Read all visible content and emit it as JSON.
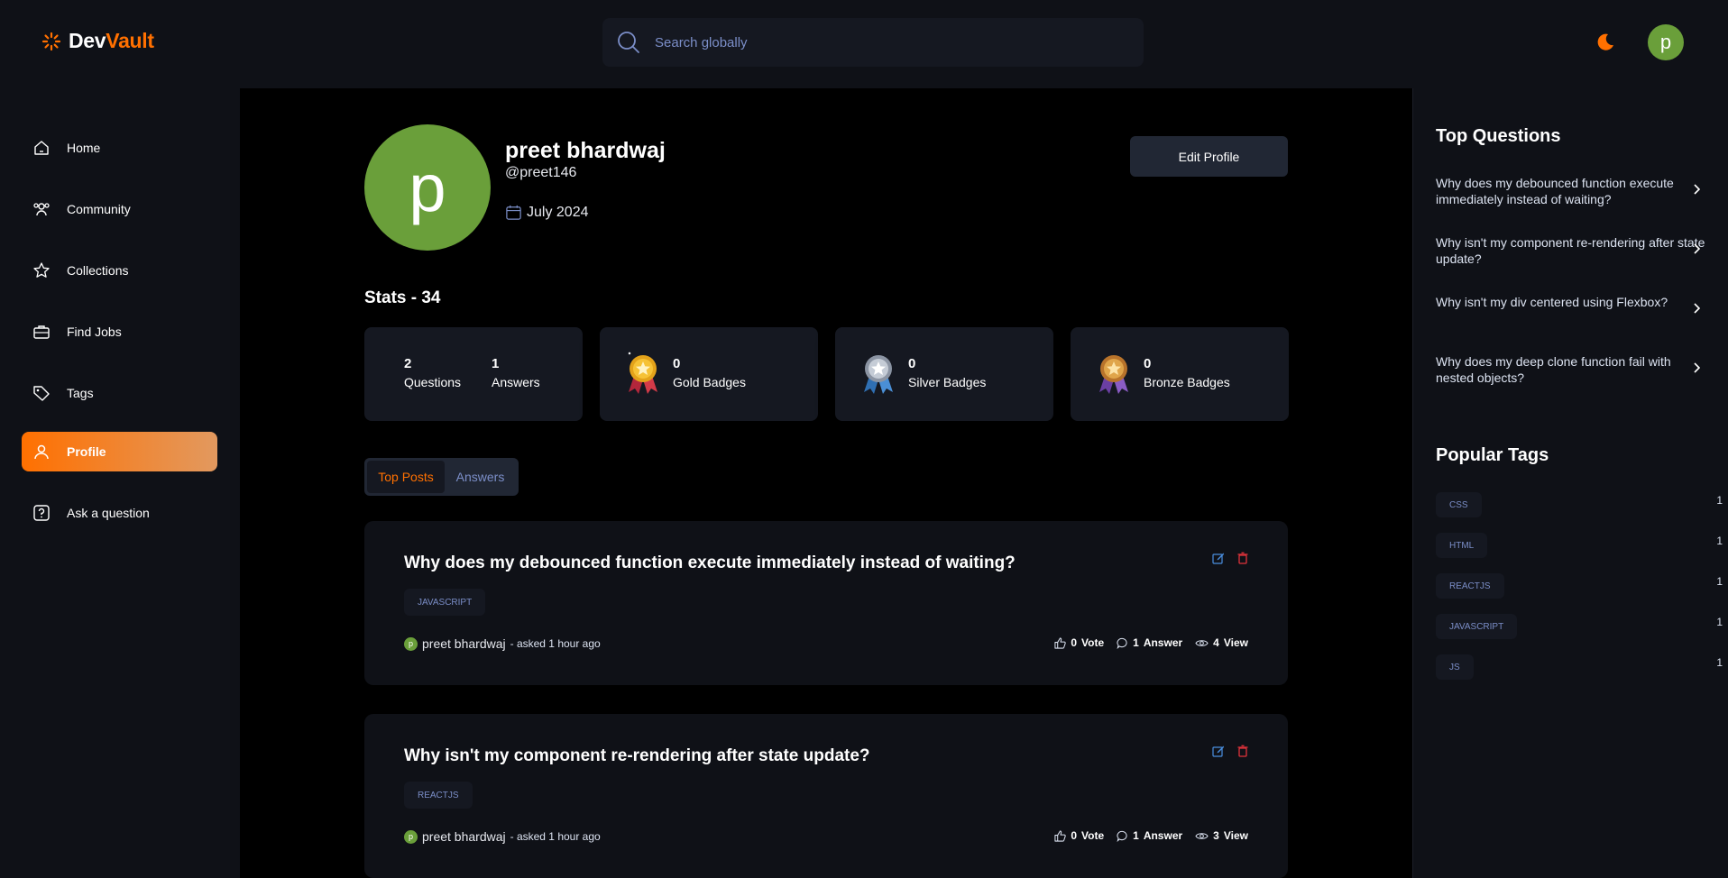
{
  "brand": {
    "name_first": "Dev",
    "name_second": "Vault"
  },
  "search": {
    "placeholder": "Search globally"
  },
  "user": {
    "avatar_letter": "p"
  },
  "sidebar": {
    "items": [
      {
        "label": "Home",
        "icon": "home-icon"
      },
      {
        "label": "Community",
        "icon": "users-icon"
      },
      {
        "label": "Collections",
        "icon": "star-icon"
      },
      {
        "label": "Find Jobs",
        "icon": "briefcase-icon"
      },
      {
        "label": "Tags",
        "icon": "tag-icon"
      },
      {
        "label": "Profile",
        "icon": "user-icon",
        "active": true
      },
      {
        "label": "Ask a question",
        "icon": "question-icon"
      }
    ]
  },
  "profile": {
    "avatar_letter": "p",
    "name": "preet bhardwaj",
    "handle": "@preet146",
    "joined": "July 2024",
    "edit_label": "Edit Profile"
  },
  "stats": {
    "title": "Stats - 34",
    "questions": {
      "value": "2",
      "label": "Questions"
    },
    "answers": {
      "value": "1",
      "label": "Answers"
    },
    "gold": {
      "value": "0",
      "label": "Gold Badges"
    },
    "silver": {
      "value": "0",
      "label": "Silver Badges"
    },
    "bronze": {
      "value": "0",
      "label": "Bronze Badges"
    }
  },
  "tabs": [
    {
      "label": "Top Posts",
      "active": true
    },
    {
      "label": "Answers",
      "active": false
    }
  ],
  "posts": [
    {
      "title": "Why does my debounced function execute immediately instead of waiting?",
      "tag": "JAVASCRIPT",
      "author_letter": "p",
      "author": "preet bhardwaj",
      "asked": " - asked 1 hour ago",
      "votes": "0",
      "votes_label": "Vote",
      "answers": "1",
      "answers_label": "Answer",
      "views": "4",
      "views_label": "View"
    },
    {
      "title": "Why isn't my component re-rendering after state update?",
      "tag": "REACTJS",
      "author_letter": "p",
      "author": "preet bhardwaj",
      "asked": " - asked 1 hour ago",
      "votes": "0",
      "votes_label": "Vote",
      "answers": "1",
      "answers_label": "Answer",
      "views": "3",
      "views_label": "View"
    }
  ],
  "right": {
    "top_questions_title": "Top Questions",
    "top_questions": [
      "Why does my debounced function execute immediately instead of waiting?",
      "Why isn't my component re-rendering after state update?",
      "Why isn't my div centered using Flexbox?",
      "Why does my deep clone function fail with nested objects?"
    ],
    "popular_tags_title": "Popular Tags",
    "popular_tags": [
      {
        "name": "CSS",
        "count": "1"
      },
      {
        "name": "HTML",
        "count": "1"
      },
      {
        "name": "REACTJS",
        "count": "1"
      },
      {
        "name": "JAVASCRIPT",
        "count": "1"
      },
      {
        "name": "JS",
        "count": "1"
      }
    ]
  },
  "colors": {
    "accent": "#ff7000",
    "avatar_green": "#6a9f3a",
    "bg_dark": "#0f1117",
    "main_bg": "#000000",
    "card_bg": "#151821",
    "muted_blue": "#7b8ec8"
  }
}
